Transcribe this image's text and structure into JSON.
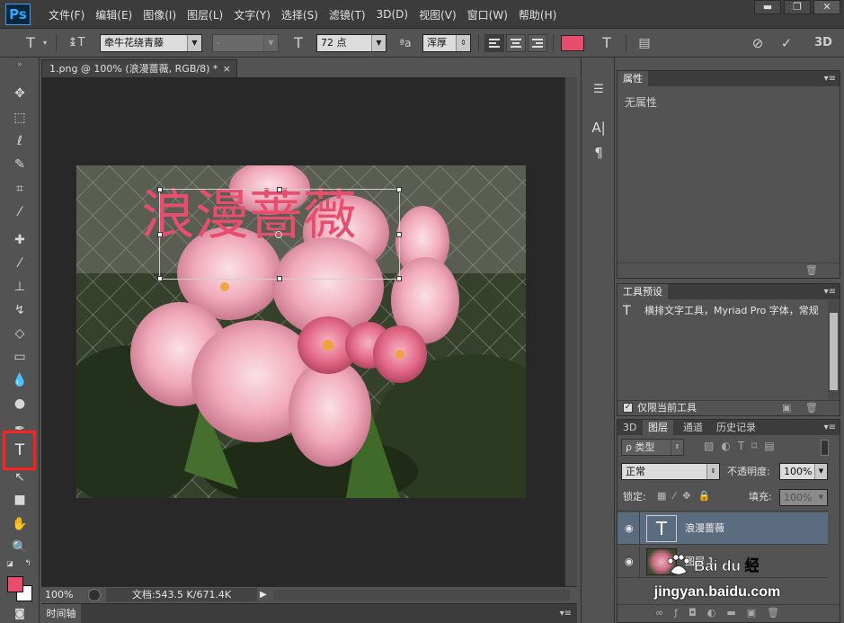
{
  "app": {
    "logo": "Ps",
    "menu": [
      "文件(F)",
      "编辑(E)",
      "图像(I)",
      "图层(L)",
      "文字(Y)",
      "选择(S)",
      "滤镜(T)",
      "3D(D)",
      "视图(V)",
      "窗口(W)",
      "帮助(H)"
    ],
    "window_controls": [
      "▬",
      "❐",
      "✕"
    ]
  },
  "options": {
    "tool_icon": "T",
    "orient_icon": "↨T",
    "font_family": "牵牛花绕青藤",
    "font_style": "-",
    "size_icon": "T",
    "font_size": "72 点",
    "aa_icon": "ªa",
    "anti_alias": "浑厚",
    "text_color": "#e84d6e",
    "warp_icon": "T",
    "panel_icon": "▤",
    "cancel_icon": "⊘",
    "commit_icon": "✓",
    "three_d": "3D"
  },
  "document": {
    "tab_title": "1.png @ 100% (浪漫蔷薇, RGB/8) *",
    "close": "×",
    "text_layer_content": "浪漫蔷薇",
    "zoom": "100%",
    "doc_info": "文档:543.5 K/671.4K",
    "status_arrow": "▶",
    "timeline_label": "时间轴"
  },
  "panels": {
    "properties": {
      "tab": "属性",
      "content": "无属性",
      "menu": "▾≡"
    },
    "tool_presets": {
      "tab": "工具预设",
      "menu": "▾≡",
      "preset_icon": "T",
      "preset_text": "横排文字工具，Myriad Pro 字体，常规",
      "checkbox_label": "仅限当前工具",
      "checkbox_mark": "✓"
    },
    "layers": {
      "tabs": [
        "3D",
        "图层",
        "通道",
        "历史记录"
      ],
      "menu": "▾≡",
      "filter_label": "ρ 类型",
      "blend_mode": "正常",
      "opacity_label": "不透明度:",
      "opacity_value": "100%",
      "lock_label": "锁定:",
      "fill_label": "填充:",
      "fill_value": "100%",
      "items": [
        {
          "name": "浪漫蔷薇",
          "thumb": "T",
          "eye": "◉"
        },
        {
          "name": "图层 1",
          "eye": "◉"
        }
      ]
    }
  },
  "watermark": {
    "logo_text": "Bai du 经验",
    "url": "jingyan.baidu.com"
  }
}
